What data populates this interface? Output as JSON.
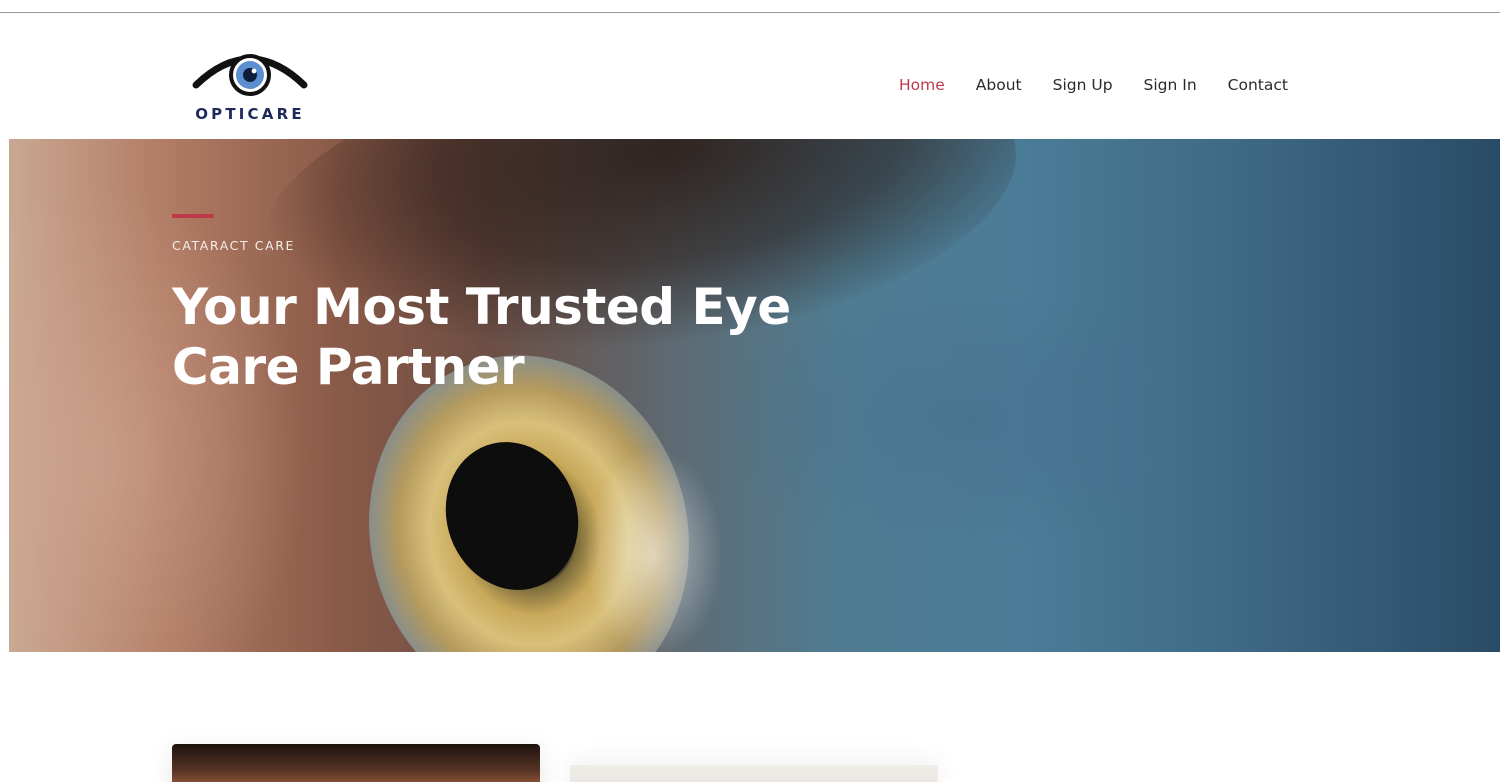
{
  "brand": {
    "name": "OPTICARE",
    "logo_icon": "eye-icon",
    "colors": {
      "navy": "#1d2a5a",
      "iris_blue": "#5b8fd0"
    }
  },
  "nav": {
    "items": [
      {
        "label": "Home",
        "active": true
      },
      {
        "label": "About",
        "active": false
      },
      {
        "label": "Sign Up",
        "active": false
      },
      {
        "label": "Sign In",
        "active": false
      },
      {
        "label": "Contact",
        "active": false
      }
    ],
    "active_color": "#c0394b"
  },
  "hero": {
    "kicker": "CATARACT CARE",
    "title": "Your Most Trusted Eye Care Partner",
    "accent_color": "#c0394b"
  }
}
